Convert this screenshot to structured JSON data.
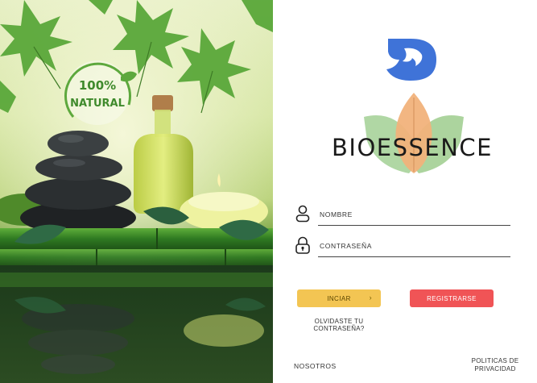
{
  "hero": {
    "badge_percent": "100%",
    "badge_text": "NATURAL"
  },
  "brand": {
    "logo_icon": "chat-bubble-logo-icon",
    "name": "BIOESSENCE",
    "leaf_colors": [
      "#9fd08e",
      "#f0b27a",
      "#a7cf94"
    ]
  },
  "form": {
    "username_label": "NOMBRE",
    "username_icon": "user-icon",
    "password_label": "CONTRASEÑA",
    "password_icon": "lock-icon"
  },
  "buttons": {
    "login_label": "INCIAR",
    "login_chevron": "›",
    "register_label": "REGISTRARSE",
    "login_color": "#f3c553",
    "register_color": "#f05456"
  },
  "links": {
    "forgot_line1": "OLVIDASTE TU",
    "forgot_line2": "CONTRASEÑA?",
    "about": "NOSOTROS",
    "privacy_line1": "POLITICAS DE",
    "privacy_line2": "PRIVACIDAD"
  }
}
